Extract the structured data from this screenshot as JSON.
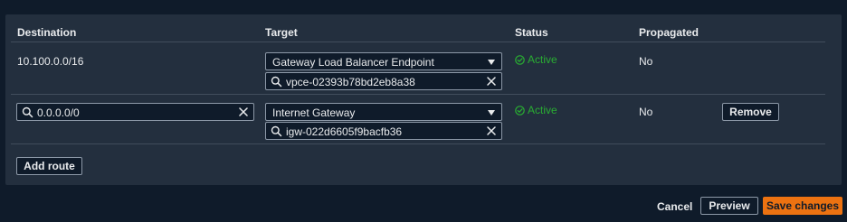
{
  "table": {
    "headers": {
      "destination": "Destination",
      "target": "Target",
      "status": "Status",
      "propagated": "Propagated"
    },
    "rows": [
      {
        "destination": "10.100.0.0/16",
        "target_type": "Gateway Load Balancer Endpoint",
        "target_id": "vpce-02393b78bd2eb8a38",
        "status": "Active",
        "propagated": "No"
      },
      {
        "destination": "0.0.0.0/0",
        "target_type": "Internet Gateway",
        "target_id": "igw-022d6605f9bacfb36",
        "status": "Active",
        "propagated": "No",
        "remove_label": "Remove"
      }
    ]
  },
  "actions": {
    "add_route": "Add route",
    "cancel": "Cancel",
    "preview": "Preview",
    "save": "Save changes"
  },
  "colors": {
    "background": "#0f1b2a",
    "panel": "#232f3e",
    "status_active": "#29ad32",
    "primary_button": "#ec7211"
  }
}
